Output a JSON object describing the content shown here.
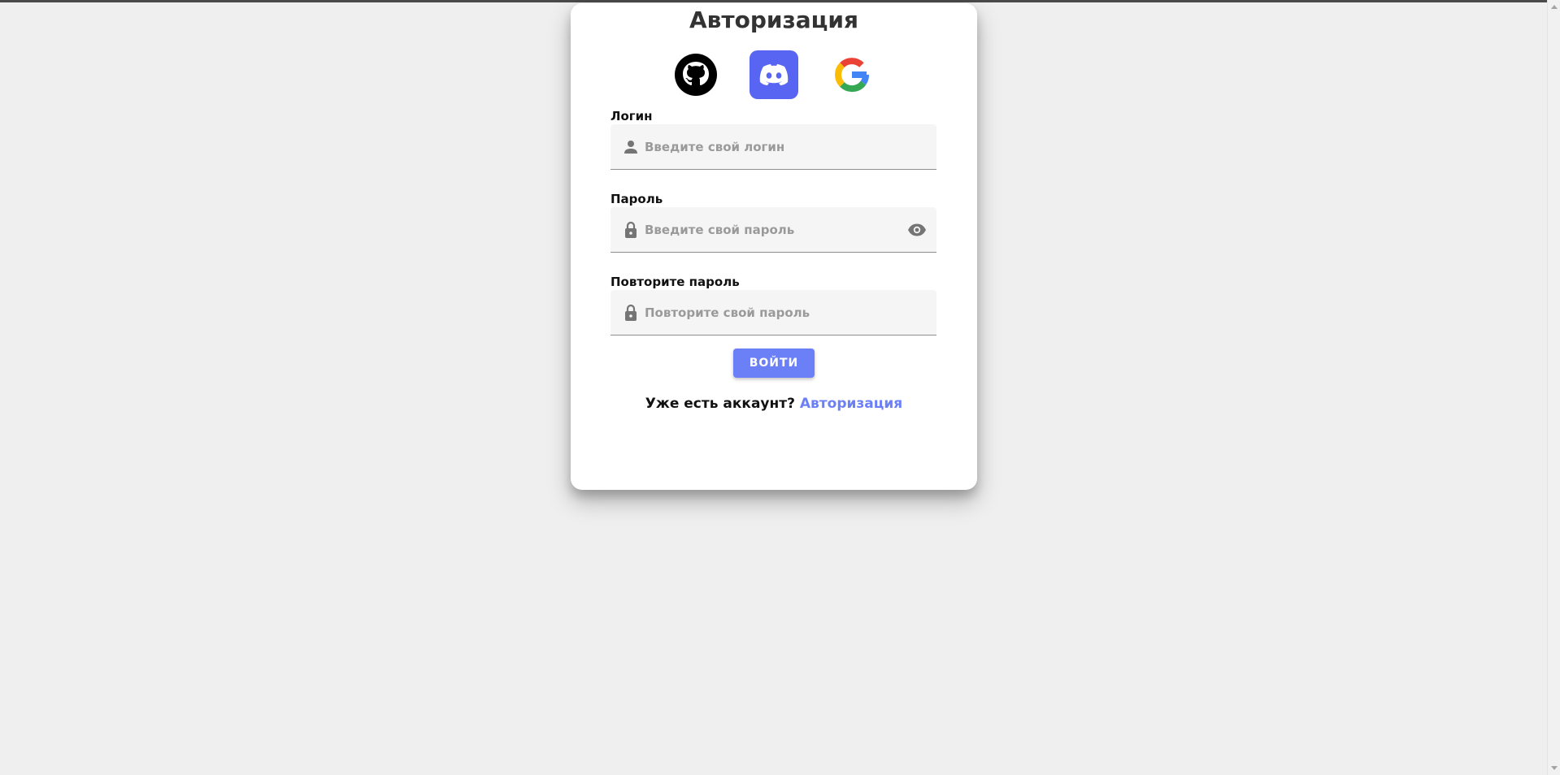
{
  "auth": {
    "title": "Авторизация",
    "social": [
      {
        "name": "GitHub",
        "icon": "github-icon",
        "color": "#000000"
      },
      {
        "name": "Discord",
        "icon": "discord-icon",
        "color": "#5865f2"
      },
      {
        "name": "Google",
        "icon": "google-icon",
        "color": "#4285f4"
      }
    ],
    "fields": {
      "login": {
        "label": "Логин",
        "placeholder": "Введите свой логин",
        "value": "",
        "icon": "person-icon"
      },
      "password": {
        "label": "Пароль",
        "placeholder": "Введите свой пароль",
        "value": "",
        "icon": "lock-icon",
        "toggle_icon": "eye-icon"
      },
      "repeat_password": {
        "label": "Повторите пароль",
        "placeholder": "Повторите свой пароль",
        "value": "",
        "icon": "lock-icon"
      }
    },
    "submit_label": "ВОЙТИ",
    "footer": {
      "text": "Уже есть аккаунт?",
      "link": "Авторизация"
    }
  },
  "colors": {
    "accent": "#6b7ff7",
    "background": "#efefef",
    "card": "#ffffff",
    "field": "#f5f5f5"
  }
}
